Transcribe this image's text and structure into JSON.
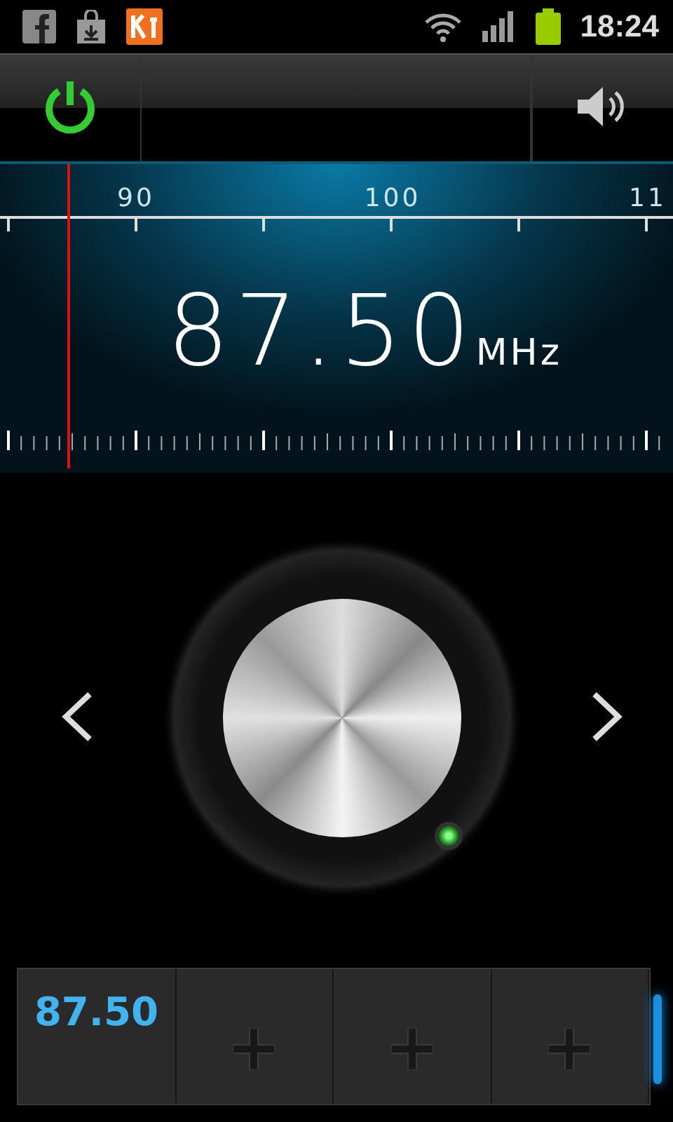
{
  "status_bar": {
    "time": "18:24"
  },
  "tuner": {
    "scale_labels": [
      "90",
      "100",
      "11"
    ],
    "frequency": "87.50",
    "unit": "MHz",
    "needle": {
      "level": 0.08
    }
  },
  "presets": [
    {
      "kind": "station",
      "label": "87.50"
    },
    {
      "kind": "empty"
    },
    {
      "kind": "empty"
    },
    {
      "kind": "empty"
    }
  ]
}
